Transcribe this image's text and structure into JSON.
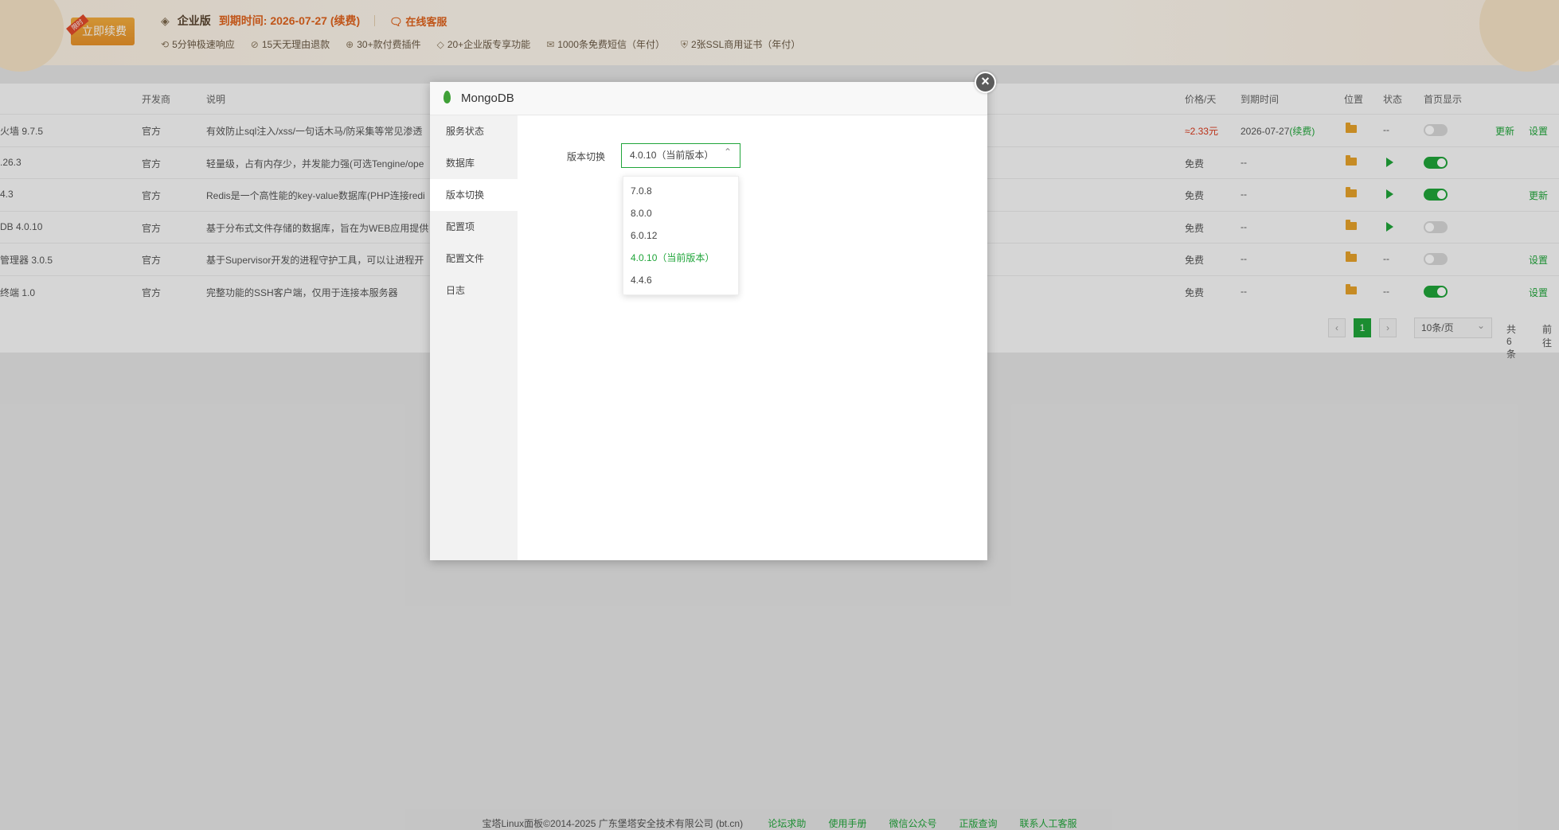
{
  "banner": {
    "renew_tag": "限时",
    "renew_label": "立即续费",
    "edition": "企业版",
    "expire": "到期时间: 2026-07-27",
    "renew_link": "(续费)",
    "service": "在线客服",
    "features": [
      {
        "icon": "headset-icon",
        "glyph": "⟲",
        "label": "5分钟极速响应"
      },
      {
        "icon": "refund-icon",
        "glyph": "⊘",
        "label": "15天无理由退款"
      },
      {
        "icon": "plugin-icon",
        "glyph": "⊕",
        "label": "30+款付费插件"
      },
      {
        "icon": "diamond-icon",
        "glyph": "◇",
        "label": "20+企业版专享功能"
      },
      {
        "icon": "mail-icon",
        "glyph": "✉",
        "label": "1000条免费短信（年付）"
      },
      {
        "icon": "ssl-icon",
        "glyph": "⛨",
        "label": "2张SSL商用证书（年付）"
      }
    ]
  },
  "table": {
    "headers": {
      "developer": "开发商",
      "desc": "说明",
      "price": "价格/天",
      "expire": "到期时间",
      "location": "位置",
      "status": "状态",
      "home": "首页显示"
    },
    "rows": [
      {
        "name": "火墙 9.7.5",
        "dev": "官方",
        "desc": "有效防止sql注入/xss/一句话木马/防采集等常见渗透",
        "price": "≈2.33元",
        "expire": "2026-07-27",
        "expire_link": "(续费)",
        "status": "--",
        "home_on": false,
        "ops": [
          "更新",
          "设置"
        ]
      },
      {
        "name": ".26.3",
        "dev": "官方",
        "desc": "轻量级，占有内存少，并发能力强(可选Tengine/ope",
        "price": "免费",
        "expire": "--",
        "status_play": true,
        "home_on": true,
        "ops": []
      },
      {
        "name": "4.3",
        "dev": "官方",
        "desc": "Redis是一个高性能的key-value数据库(PHP连接redi",
        "price": "免费",
        "expire": "--",
        "status_play": true,
        "home_on": true,
        "ops": [
          "更新"
        ]
      },
      {
        "name": "DB 4.0.10",
        "dev": "官方",
        "desc": "基于分布式文件存储的数据库，旨在为WEB应用提供",
        "price": "免费",
        "expire": "--",
        "status_play": true,
        "home_on": false,
        "ops": []
      },
      {
        "name": "管理器 3.0.5",
        "dev": "官方",
        "desc": "基于Supervisor开发的进程守护工具，可以让进程开",
        "price": "免费",
        "expire": "--",
        "status": "--",
        "home_on": false,
        "ops": [
          "设置"
        ]
      },
      {
        "name": "终端 1.0",
        "dev": "官方",
        "desc": "完整功能的SSH客户端，仅用于连接本服务器",
        "price": "免费",
        "expire": "--",
        "status": "--",
        "home_on": true,
        "ops": [
          "设置"
        ]
      }
    ],
    "pager": {
      "prev": "‹",
      "page": "1",
      "next": "›",
      "size": "10条/页",
      "total": "共 6 条",
      "goto": "前往"
    }
  },
  "modal": {
    "title": "MongoDB",
    "close": "×",
    "nav": [
      "服务状态",
      "数据库",
      "版本切换",
      "配置项",
      "配置文件",
      "日志"
    ],
    "active_nav": 2,
    "version_label": "版本切换",
    "version_selected": "4.0.10（当前版本）",
    "options": [
      "7.0.8",
      "8.0.0",
      "6.0.12",
      "4.0.10（当前版本）",
      "4.4.6"
    ],
    "selected_option": 3
  },
  "footer": {
    "copyright": "宝塔Linux面板©2014-2025 广东堡塔安全技术有限公司 (bt.cn)",
    "links": [
      "论坛求助",
      "使用手册",
      "微信公众号",
      "正版查询",
      "联系人工客服"
    ]
  },
  "colors": {
    "accent": "#20a53a",
    "warn": "#e0641e",
    "price_red": "#d9391c"
  }
}
